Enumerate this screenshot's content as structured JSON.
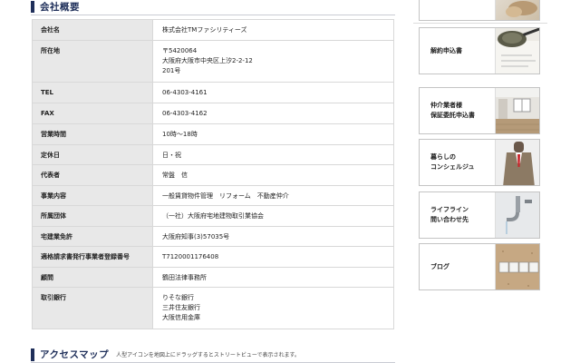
{
  "company": {
    "title": "会社概要",
    "rows": [
      {
        "label": "会社名",
        "value": [
          "株式会社TMファシリティーズ"
        ]
      },
      {
        "label": "所在地",
        "value": [
          "〒5420064",
          "大阪府大阪市中央区上汐2-2-12",
          "201号"
        ]
      },
      {
        "label": "TEL",
        "value": [
          "06-4303-4161"
        ]
      },
      {
        "label": "FAX",
        "value": [
          "06-4303-4162"
        ]
      },
      {
        "label": "営業時間",
        "value": [
          "10時〜18時"
        ]
      },
      {
        "label": "定休日",
        "value": [
          "日・祝"
        ]
      },
      {
        "label": "代表者",
        "value": [
          "常盤　信"
        ]
      },
      {
        "label": "事業内容",
        "value": [
          "一般賃貸物件管理　リフォーム　不動産仲介"
        ]
      },
      {
        "label": "所属団体",
        "value": [
          "（一社）大阪府宅地建物取引業協会"
        ]
      },
      {
        "label": "宅建業免許",
        "value": [
          "大阪府知事(3)57035号"
        ]
      },
      {
        "label": "適格請求書発行事業者登録番号",
        "value": [
          "T7120001176408"
        ]
      },
      {
        "label": "顧問",
        "value": [
          "鶴田法律事務所"
        ]
      },
      {
        "label": "取引銀行",
        "value": [
          "りそな銀行",
          "三井住友銀行",
          "大阪信用金庫"
        ]
      }
    ]
  },
  "access": {
    "title": "アクセスマップ",
    "note": "人型アイコンを地図上にドラッグするとストリートビューで表示されます。"
  },
  "sidebar": {
    "cards": [
      {
        "lines": [
          "解約申込書"
        ],
        "icon": "contract-pen-icon"
      },
      {
        "lines": [
          "仲介業者様",
          "保証委託申込書"
        ],
        "icon": "room-interior-icon"
      },
      {
        "lines": [
          "暮らしの",
          "コンシェルジュ"
        ],
        "icon": "concierge-icon"
      },
      {
        "lines": [
          "ライフライン",
          "問い合わせ先"
        ],
        "icon": "faucet-icon"
      },
      {
        "lines": [
          "ブログ"
        ],
        "icon": "blog-blocks-icon"
      }
    ]
  },
  "colors": {
    "accent": "#1f2f5a",
    "label_bg": "#e8e8e8",
    "border": "#d8d8d8"
  }
}
